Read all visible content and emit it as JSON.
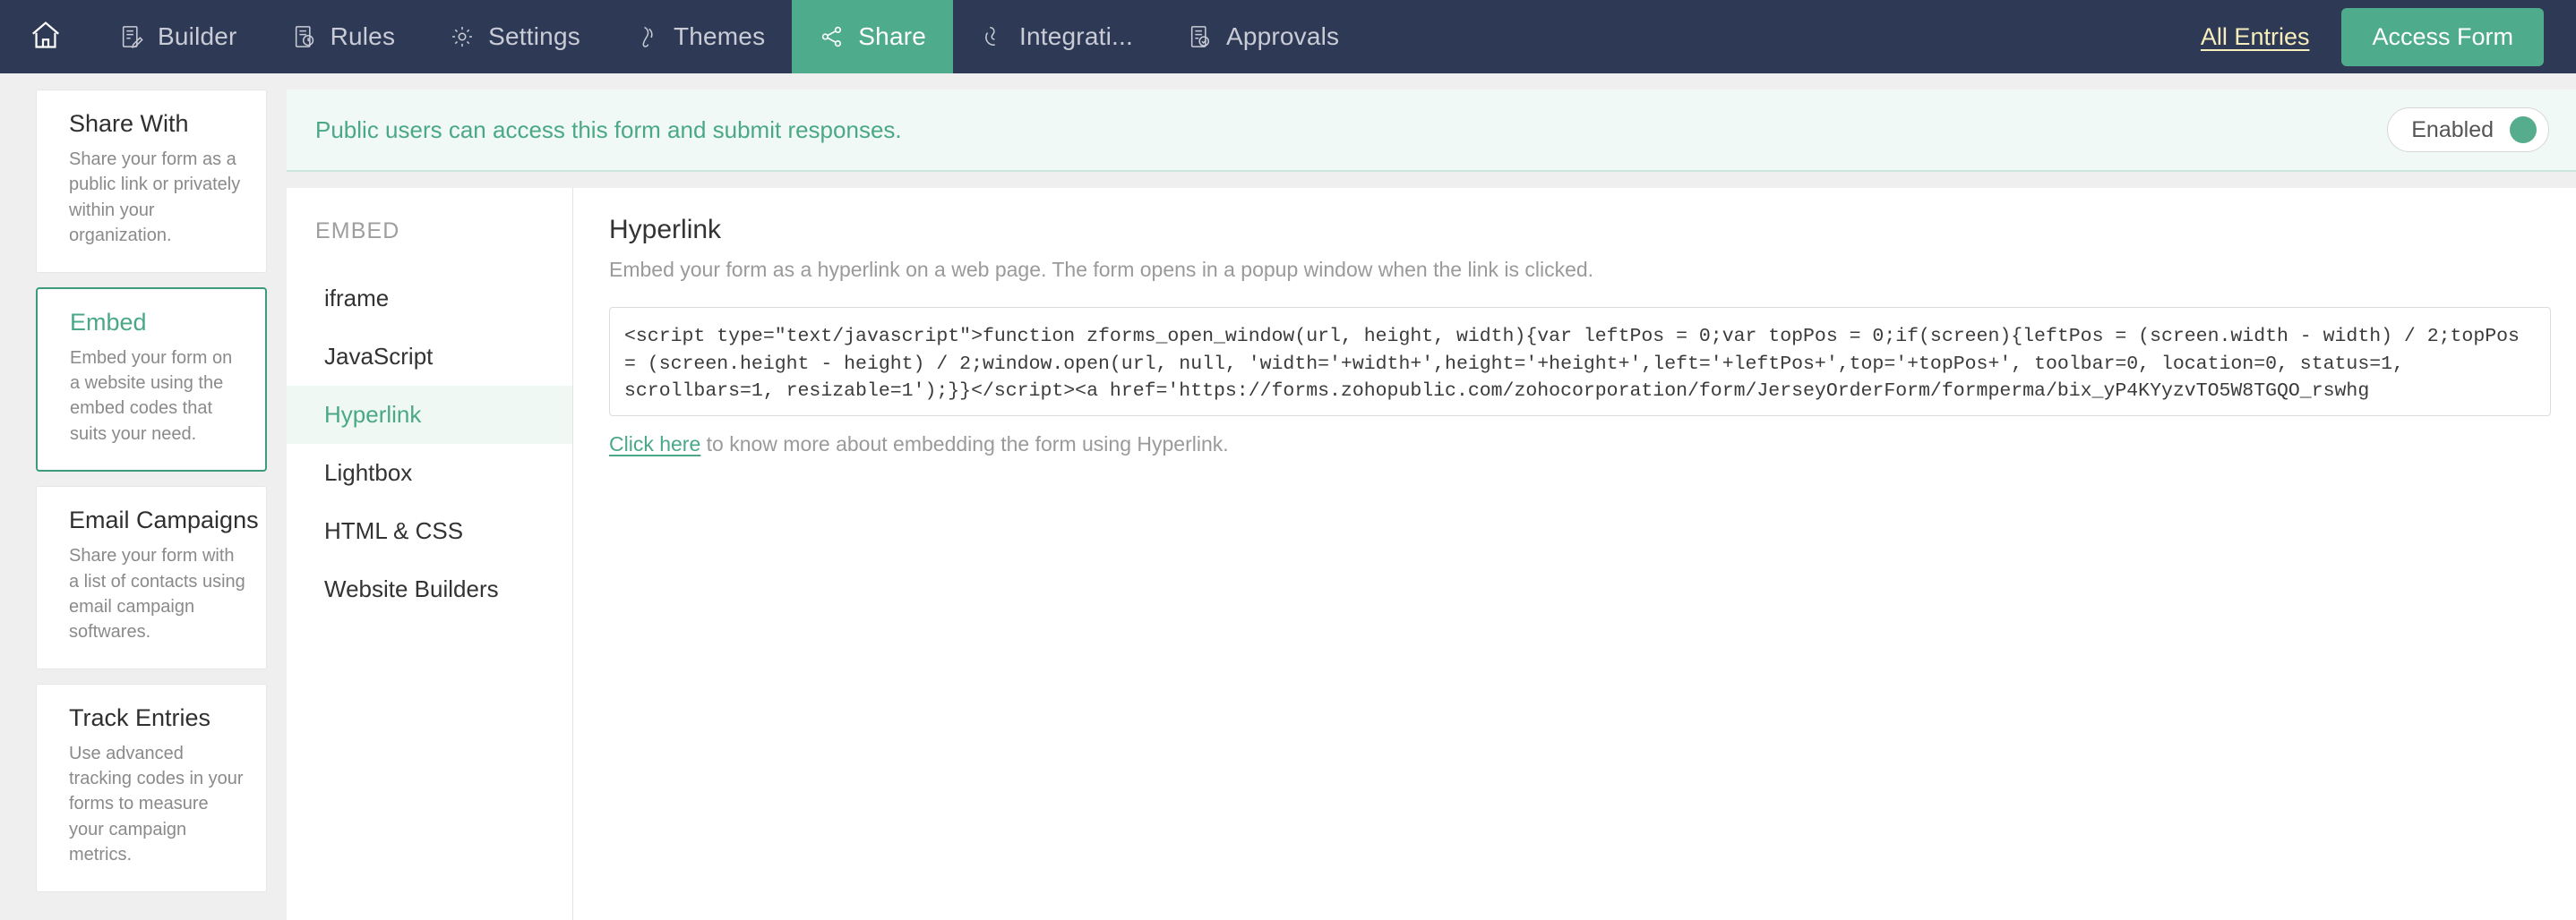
{
  "topnav": {
    "home_icon": "home-icon",
    "items": [
      {
        "label": "Builder",
        "icon": "builder-icon",
        "active": false
      },
      {
        "label": "Rules",
        "icon": "rules-icon",
        "active": false
      },
      {
        "label": "Settings",
        "icon": "gear-icon",
        "active": false
      },
      {
        "label": "Themes",
        "icon": "themes-icon",
        "active": false
      },
      {
        "label": "Share",
        "icon": "share-icon",
        "active": true
      },
      {
        "label": "Integrati...",
        "icon": "integrations-icon",
        "active": false
      },
      {
        "label": "Approvals",
        "icon": "approvals-icon",
        "active": false
      }
    ],
    "all_entries_label": "All Entries",
    "access_form_label": "Access Form",
    "accent_color": "#4eab8b",
    "bar_color": "#2e3a55",
    "link_color": "#f7eebc"
  },
  "sidebar": {
    "cards": [
      {
        "title": "Share With",
        "desc": "Share your form as a public link or privately within your organization.",
        "selected": false
      },
      {
        "title": "Embed",
        "desc": "Embed your form on a website using the embed codes that suits your need.",
        "selected": true
      },
      {
        "title": "Email Campaigns",
        "desc": "Share your form with a list of contacts using email campaign softwares.",
        "selected": false
      },
      {
        "title": "Track Entries",
        "desc": "Use advanced tracking codes in your forms to measure your campaign metrics.",
        "selected": false
      }
    ]
  },
  "banner": {
    "message": "Public users can access this form and submit responses.",
    "toggle_label": "Enabled",
    "toggle_state": "on",
    "toggle_color": "#56ad8d",
    "text_color": "#4aa886"
  },
  "embed": {
    "heading": "EMBED",
    "items": [
      {
        "label": "iframe",
        "active": false
      },
      {
        "label": "JavaScript",
        "active": false
      },
      {
        "label": "Hyperlink",
        "active": true
      },
      {
        "label": "Lightbox",
        "active": false
      },
      {
        "label": "HTML & CSS",
        "active": false
      },
      {
        "label": "Website Builders",
        "active": false
      }
    ]
  },
  "detail": {
    "title": "Hyperlink",
    "subtitle": "Embed your form as a hyperlink on a web page. The form opens in a popup window when the link is clicked.",
    "code": "<script type=\"text/javascript\">function zforms_open_window(url, height, width){var leftPos = 0;var topPos = 0;if(screen){leftPos = (screen.width - width) / 2;topPos = (screen.height - height) / 2;window.open(url, null, 'width='+width+',height='+height+',left='+leftPos+',top='+topPos+', toolbar=0, location=0, status=1, scrollbars=1, resizable=1');}}</script><a href='https://forms.zohopublic.com/zohocorporation/form/JerseyOrderForm/formperma/bix_yP4KYyzvTO5W8TGQO_rswhg",
    "helper_link": "Click here",
    "helper_text": " to know more about embedding the form using Hyperlink."
  }
}
